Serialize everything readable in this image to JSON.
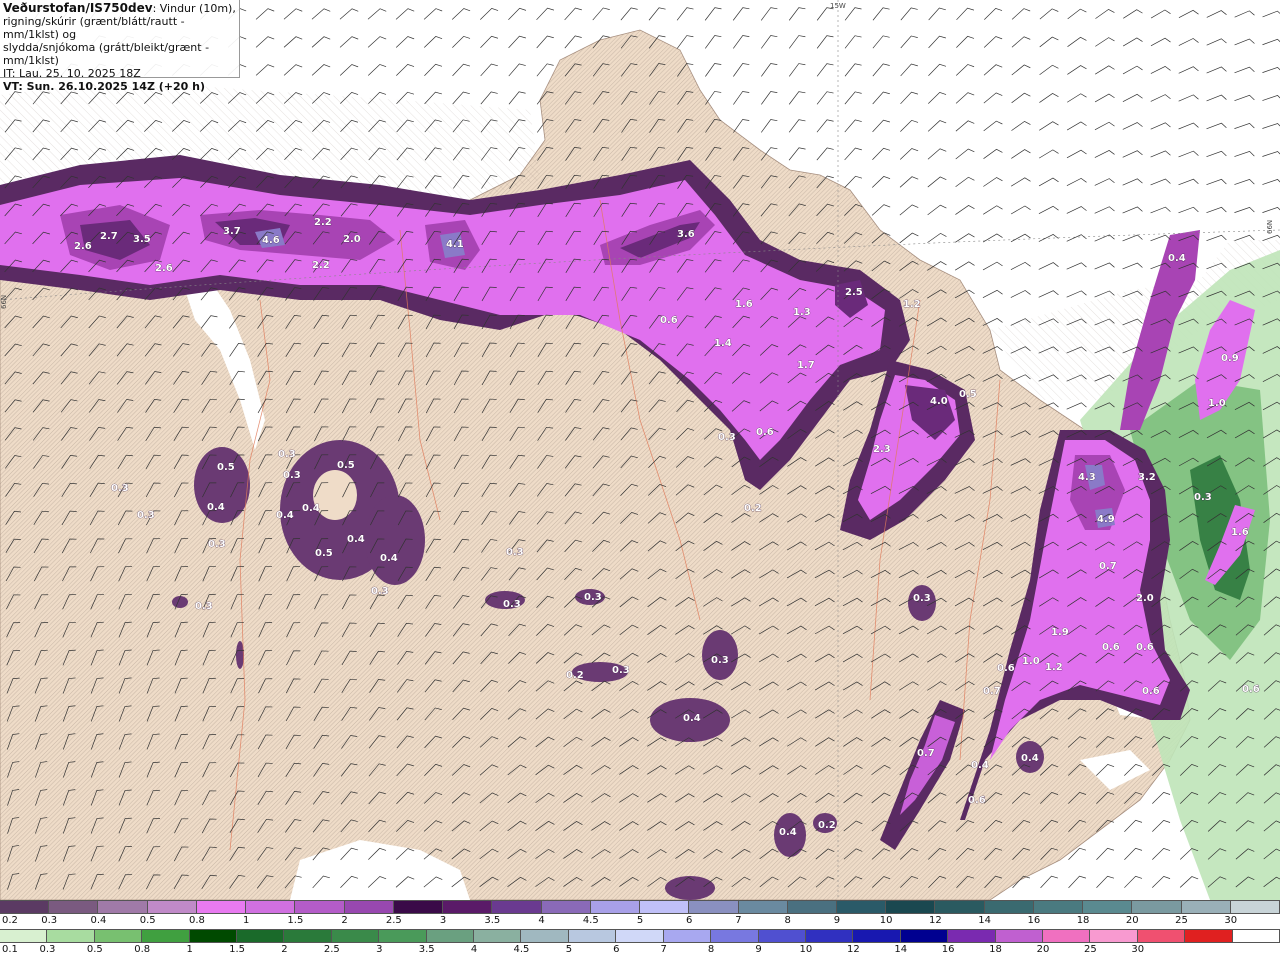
{
  "header": {
    "source": "Veðurstofan/IS750dev",
    "line1_rest": ": Vindur (10m),",
    "line2": "rigning/skúrir (grænt/blátt/rautt - mm/1klst) og",
    "line3": "slydda/snjókoma (grátt/bleikt/grænt - mm/1klst)",
    "it_line": "IT: Lau. 25. 10. 2025 18Z",
    "vt_line": "VT: Sun. 26.10.2025 14Z (+20 h)"
  },
  "grid_labels": {
    "lon": "15W",
    "lat_left": "66N",
    "lat_right": "66N"
  },
  "colors": {
    "sea": "#ffffff",
    "land": "#efdcc8",
    "sleet_dark": "#5a2a63",
    "sleet_mid": "#a844b4",
    "sleet_bright": "#e86af0",
    "rain_green": "#9fd49a",
    "rain_dark_green": "#2f7a3e"
  },
  "precip_labels": [
    {
      "text": "2.6"
    },
    {
      "text": "2.7"
    },
    {
      "text": "3.5"
    },
    {
      "text": "2.6"
    },
    {
      "text": "3.7"
    },
    {
      "text": "4.6"
    },
    {
      "text": "2.2"
    },
    {
      "text": "2.0"
    },
    {
      "text": "2.2"
    },
    {
      "text": "4.1"
    },
    {
      "text": "3.6"
    },
    {
      "text": "2.5"
    },
    {
      "text": "1.2"
    },
    {
      "text": "1.6"
    },
    {
      "text": "1.3"
    },
    {
      "text": "0.6"
    },
    {
      "text": "1.4"
    },
    {
      "text": "1.7"
    },
    {
      "text": "0.3"
    },
    {
      "text": "0.6"
    },
    {
      "text": "0.2"
    },
    {
      "text": "4.0"
    },
    {
      "text": "0.5"
    },
    {
      "text": "2.3"
    },
    {
      "text": "0.4"
    },
    {
      "text": "0.9"
    },
    {
      "text": "1.0"
    },
    {
      "text": "4.3"
    },
    {
      "text": "3.2"
    },
    {
      "text": "4.9"
    },
    {
      "text": "0.3"
    },
    {
      "text": "1.6"
    },
    {
      "text": "0.7"
    },
    {
      "text": "2.0"
    },
    {
      "text": "1.9"
    },
    {
      "text": "0.6"
    },
    {
      "text": "1.0"
    },
    {
      "text": "1.2"
    },
    {
      "text": "0.6"
    },
    {
      "text": "0.6"
    },
    {
      "text": "0.7"
    },
    {
      "text": "0.6"
    },
    {
      "text": "0.7"
    },
    {
      "text": "0.4"
    },
    {
      "text": "0.4"
    },
    {
      "text": "0.6"
    },
    {
      "text": "0.5"
    },
    {
      "text": "0.3"
    },
    {
      "text": "0.4"
    },
    {
      "text": "0.3"
    },
    {
      "text": "0.3"
    },
    {
      "text": "0.3"
    },
    {
      "text": "0.5"
    },
    {
      "text": "0.3"
    },
    {
      "text": "0.4"
    },
    {
      "text": "0.4"
    },
    {
      "text": "0.5"
    },
    {
      "text": "0.3"
    },
    {
      "text": "0.4"
    },
    {
      "text": "0.3"
    },
    {
      "text": "0.3"
    },
    {
      "text": "0.4"
    },
    {
      "text": "0.3"
    },
    {
      "text": "0.3"
    },
    {
      "text": "0.2"
    },
    {
      "text": "0.3"
    },
    {
      "text": "0.4"
    },
    {
      "text": "0.3"
    },
    {
      "text": "0.4"
    },
    {
      "text": "0.2"
    },
    {
      "text": "0.3"
    },
    {
      "text": "0.6"
    }
  ],
  "legend_precip": {
    "colors": [
      "#5b3a63",
      "#7a5a80",
      "#a07aa8",
      "#c08ac8",
      "#e87af0",
      "#d070e0",
      "#b45cc8",
      "#9848b0",
      "#3a0a48",
      "#5a1a68",
      "#6a3a90",
      "#8a6ab8",
      "#a8a0e8",
      "#c0c0f8",
      "#8a90c0",
      "#6a8aa0",
      "#4a7080",
      "#2a5a68",
      "#1a4850",
      "#2a5a60",
      "#3a6a70",
      "#4a7a80",
      "#5a8a90",
      "#7a9aa0",
      "#9ab0b8",
      "#c8d4d8"
    ],
    "labels": [
      "0.2",
      "0.3",
      "0.4",
      "0.5",
      "0.8",
      "1",
      "1.5",
      "2",
      "2.5",
      "3",
      "3.5",
      "4",
      "4.5",
      "5",
      "6",
      "7",
      "8",
      "9",
      "10",
      "12",
      "14",
      "16",
      "18",
      "20",
      "25",
      "30"
    ]
  },
  "legend_rain": {
    "colors": [
      "#d8f0d0",
      "#a8dca0",
      "#78c070",
      "#40a040",
      "#004a00",
      "#1a6a2a",
      "#2a7a3a",
      "#3a8a4a",
      "#4a9a5a",
      "#6aa080",
      "#8ab0a0",
      "#a0b8c0",
      "#b8c8e0",
      "#d0d8f8",
      "#a8a8f0",
      "#7878e0",
      "#5050d0",
      "#3030c0",
      "#1818b0",
      "#000090",
      "#7a2ab0",
      "#c060d0",
      "#f070c0",
      "#f89ad0",
      "#f05070",
      "#e02020",
      "#ffffff"
    ],
    "labels": [
      "0.1",
      "0.3",
      "0.5",
      "0.8",
      "1",
      "1.5",
      "2",
      "2.5",
      "3",
      "3.5",
      "4",
      "4.5",
      "5",
      "6",
      "7",
      "8",
      "9",
      "10",
      "12",
      "14",
      "16",
      "18",
      "20",
      "25",
      "30"
    ]
  }
}
